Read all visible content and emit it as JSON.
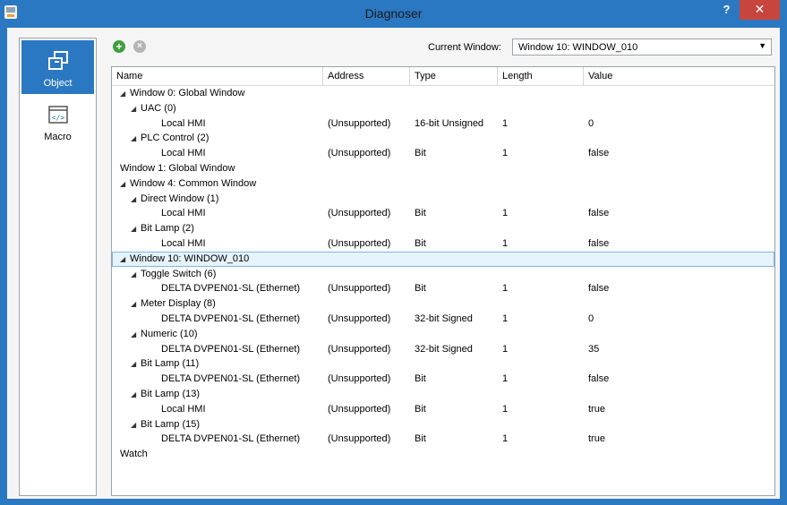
{
  "window": {
    "title": "Diagnoser",
    "help": "?",
    "close": "✕"
  },
  "sidebar": {
    "items": [
      {
        "label": "Object",
        "active": true
      },
      {
        "label": "Macro",
        "active": false
      }
    ]
  },
  "toolbar": {
    "add": "+",
    "delete": "×",
    "current_window_label": "Current Window:",
    "current_window_value": "Window 10: WINDOW_010"
  },
  "columns": [
    "Name",
    "Address",
    "Type",
    "Length",
    "Value"
  ],
  "rows": [
    {
      "level": 0,
      "expander": true,
      "name": "Window 0: Global Window"
    },
    {
      "level": 1,
      "expander": true,
      "name": "UAC (0)"
    },
    {
      "level": 2,
      "expander": false,
      "name": "Local HMI",
      "address": "(Unsupported)",
      "type": "16-bit Unsigned",
      "length": "1",
      "value": "0"
    },
    {
      "level": 1,
      "expander": true,
      "name": "PLC Control (2)"
    },
    {
      "level": 2,
      "expander": false,
      "name": "Local HMI",
      "address": "(Unsupported)",
      "type": "Bit",
      "length": "1",
      "value": "false"
    },
    {
      "level": 0,
      "expander": false,
      "name": "Window 1: Global Window"
    },
    {
      "level": 0,
      "expander": true,
      "name": "Window 4: Common Window"
    },
    {
      "level": 1,
      "expander": true,
      "name": "Direct Window (1)"
    },
    {
      "level": 2,
      "expander": false,
      "name": "Local HMI",
      "address": "(Unsupported)",
      "type": "Bit",
      "length": "1",
      "value": "false"
    },
    {
      "level": 1,
      "expander": true,
      "name": "Bit Lamp (2)"
    },
    {
      "level": 2,
      "expander": false,
      "name": "Local HMI",
      "address": "(Unsupported)",
      "type": "Bit",
      "length": "1",
      "value": "false"
    },
    {
      "level": 0,
      "expander": true,
      "name": "Window 10: WINDOW_010",
      "selected": true
    },
    {
      "level": 1,
      "expander": true,
      "name": "Toggle Switch (6)"
    },
    {
      "level": 2,
      "expander": false,
      "name": "DELTA DVPEN01-SL (Ethernet)",
      "address": "(Unsupported)",
      "type": "Bit",
      "length": "1",
      "value": "false"
    },
    {
      "level": 1,
      "expander": true,
      "name": "Meter Display (8)"
    },
    {
      "level": 2,
      "expander": false,
      "name": "DELTA DVPEN01-SL (Ethernet)",
      "address": "(Unsupported)",
      "type": "32-bit Signed",
      "length": "1",
      "value": "0"
    },
    {
      "level": 1,
      "expander": true,
      "name": "Numeric (10)"
    },
    {
      "level": 2,
      "expander": false,
      "name": "DELTA DVPEN01-SL (Ethernet)",
      "address": "(Unsupported)",
      "type": "32-bit Signed",
      "length": "1",
      "value": "35"
    },
    {
      "level": 1,
      "expander": true,
      "name": "Bit Lamp (11)"
    },
    {
      "level": 2,
      "expander": false,
      "name": "DELTA DVPEN01-SL (Ethernet)",
      "address": "(Unsupported)",
      "type": "Bit",
      "length": "1",
      "value": "false"
    },
    {
      "level": 1,
      "expander": true,
      "name": "Bit Lamp (13)"
    },
    {
      "level": 2,
      "expander": false,
      "name": "Local HMI",
      "address": "(Unsupported)",
      "type": "Bit",
      "length": "1",
      "value": "true"
    },
    {
      "level": 1,
      "expander": true,
      "name": "Bit Lamp (15)"
    },
    {
      "level": 2,
      "expander": false,
      "name": "DELTA DVPEN01-SL (Ethernet)",
      "address": "(Unsupported)",
      "type": "Bit",
      "length": "1",
      "value": "true"
    },
    {
      "level": 0,
      "expander": false,
      "name": "Watch"
    }
  ],
  "icons": {
    "object": "object-icon",
    "macro": "macro-icon",
    "expander": "expand-triangle-icon"
  },
  "colors": {
    "accent": "#2b78c2",
    "close": "#c7453c",
    "add": "#3f9f3f",
    "selection": "#e5f3fb"
  }
}
